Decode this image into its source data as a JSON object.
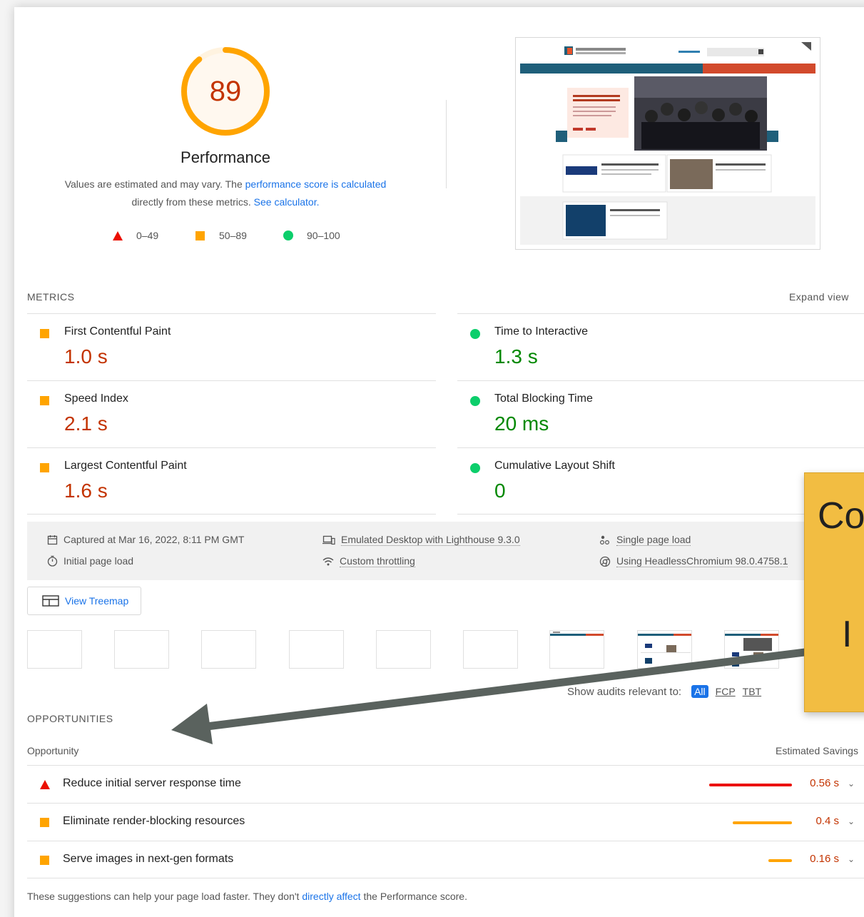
{
  "score": {
    "value": "89",
    "fraction": 0.89
  },
  "performance": {
    "title": "Performance",
    "desc_prefix": "Values are estimated and may vary. The ",
    "desc_link1": "performance score is calculated",
    "desc_middle": "directly from these metrics. ",
    "desc_link2": "See calculator."
  },
  "legend": [
    {
      "label": "0–49",
      "color": "#eb0f00",
      "icon": "triangle-icon"
    },
    {
      "label": "50–89",
      "color": "#ffa400",
      "icon": "square-icon"
    },
    {
      "label": "90–100",
      "color": "#0cce6b",
      "icon": "circle-icon"
    }
  ],
  "metrics": {
    "label": "METRICS",
    "expand": "Expand view",
    "items": [
      {
        "name": "First Contentful Paint",
        "value": "1.0 s",
        "status": "average"
      },
      {
        "name": "Time to Interactive",
        "value": "1.3 s",
        "status": "good"
      },
      {
        "name": "Speed Index",
        "value": "2.1 s",
        "status": "average"
      },
      {
        "name": "Total Blocking Time",
        "value": "20 ms",
        "status": "good"
      },
      {
        "name": "Largest Contentful Paint",
        "value": "1.6 s",
        "status": "average"
      },
      {
        "name": "Cumulative Layout Shift",
        "value": "0",
        "status": "good"
      }
    ]
  },
  "info": {
    "captured": "Captured at Mar 16, 2022, 8:11 PM GMT",
    "initial_load": "Initial page load",
    "emulated": "Emulated Desktop with Lighthouse 9.3.0",
    "throttling": "Custom throttling",
    "single_page": "Single page load",
    "browser": "Using HeadlessChromium 98.0.4758.1"
  },
  "treemap_label": "View Treemap",
  "filter": {
    "label": "Show audits relevant to:",
    "all": "All",
    "fcp": "FCP",
    "tbt": "TBT"
  },
  "opportunities": {
    "label": "OPPORTUNITIES",
    "col_opportunity": "Opportunity",
    "col_savings": "Estimated Savings",
    "items": [
      {
        "name": "Reduce initial server response time",
        "savings": "0.56 s",
        "savings_s": 0.56,
        "status": "fail"
      },
      {
        "name": "Eliminate render-blocking resources",
        "savings": "0.4 s",
        "savings_s": 0.4,
        "status": "average"
      },
      {
        "name": "Serve images in next-gen formats",
        "savings": "0.16 s",
        "savings_s": 0.16,
        "status": "average"
      }
    ],
    "footer_prefix": "These suggestions can help your page load faster. They don't ",
    "footer_link": "directly affect",
    "footer_suffix": " the Performance score."
  },
  "callout": {
    "line1": "Co",
    "line2": "I"
  },
  "colors": {
    "orange": "#c33300",
    "green": "#008800",
    "red": "#eb0f00",
    "gauge": "#ffa400",
    "link": "#1a73e8",
    "arrow": "#5a625e"
  }
}
